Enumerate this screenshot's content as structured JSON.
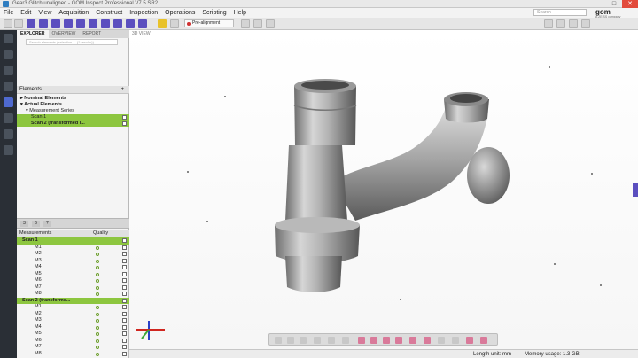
{
  "window": {
    "title": "Gear3 Glitch unaligned - GOM Inspect Professional V7.5 SR2",
    "minimize": "–",
    "maximize": "□",
    "close": "✕"
  },
  "menu": [
    "File",
    "Edit",
    "View",
    "Acquisition",
    "Construct",
    "Inspection",
    "Operations",
    "Scripting",
    "Help"
  ],
  "search": {
    "placeholder": "Search"
  },
  "brand": {
    "logo": "gom",
    "subtitle": "A ZEISS company"
  },
  "toolbar": {
    "alignment_label": "Pre-alignment"
  },
  "explorer": {
    "tabs": [
      "EXPLORER",
      "OVERVIEW",
      "REPORT"
    ],
    "search_placeholder": "Search elements (selection ... (? results))",
    "elements_header": "Elements",
    "pin": "+",
    "tree": [
      {
        "label": "Nominal Elements",
        "bold": true,
        "highlight": false
      },
      {
        "label": "Actual Elements",
        "bold": true,
        "highlight": false
      },
      {
        "label": "Measurement Series",
        "bold": false,
        "highlight": false
      },
      {
        "label": "Scan 1",
        "bold": false,
        "highlight": true
      },
      {
        "label": "Scan 2 (transformed i...",
        "bold": true,
        "highlight": true
      }
    ],
    "split_tabs": [
      "3",
      "6",
      "?"
    ],
    "measurements_header": "Measurements",
    "quality_header": "Quality",
    "scans": [
      {
        "label": "Scan 1",
        "items": [
          "M1",
          "M2",
          "M3",
          "M4",
          "M5",
          "M6",
          "M7",
          "M8"
        ]
      },
      {
        "label": "Scan 2 (transforme...",
        "items": [
          "M1",
          "M2",
          "M3",
          "M4",
          "M5",
          "M6",
          "M7",
          "M8"
        ]
      }
    ]
  },
  "viewport": {
    "tab_label": "3D VIEW"
  },
  "status": {
    "length_unit": "Length unit: mm",
    "memory_usage": "Memory usage: 1.3 GB"
  },
  "colors": {
    "accent": "#5b4fbf",
    "highlight": "#8dc63f",
    "sidebar": "#2a2f36",
    "close": "#e24a3b"
  }
}
